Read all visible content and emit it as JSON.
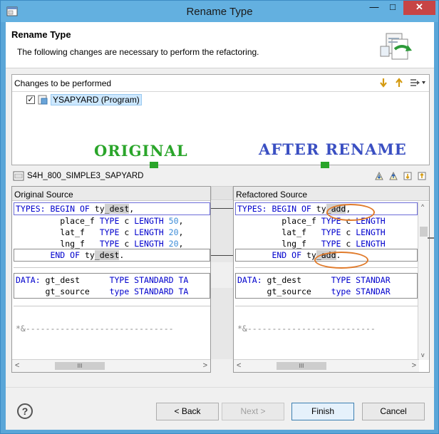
{
  "window": {
    "title": "Rename Type",
    "min_glyph": "—",
    "max_glyph": "□",
    "close_glyph": "✕"
  },
  "header": {
    "title": "Rename Type",
    "description": "The following changes are necessary to perform the refactoring."
  },
  "changes": {
    "title": "Changes to be performed",
    "item": {
      "label": "YSAPYARD (Program)",
      "checked": true
    }
  },
  "annotations": {
    "original": "ORIGINAL",
    "after": "AFTER RENAME"
  },
  "preview": {
    "file": "S4H_800_SIMPLE3_SAPYARD",
    "left_title": "Original Source",
    "right_title": "Refactored Source",
    "left_lines": {
      "l1a": "TYPES: BEGIN OF ",
      "l1b": "ty",
      "l1c": "_dest",
      "l1d": ",",
      "l2a": "         place_f ",
      "l2b": "TYPE",
      "l2c": " c ",
      "l2d": "LENGTH",
      "l2e": " 50",
      "l2f": ",",
      "l3a": "         lat_f   ",
      "l3b": "TYPE",
      "l3c": " c ",
      "l3d": "LENGTH",
      "l3e": " 20",
      "l3f": ",",
      "l4a": "         lng_f   ",
      "l4b": "TYPE",
      "l4c": " c ",
      "l4d": "LENGTH",
      "l4e": " 20",
      "l4f": ",",
      "l5a": "       END OF ",
      "l5b": "ty",
      "l5c": "_dest",
      "l5d": ".",
      "l6a": "DATA: ",
      "l6b": "gt_dest      ",
      "l6c": "TYPE STANDARD TA",
      "l7a": "      gt_source    ",
      "l7b": "type STANDARD TA",
      "l8": "*&------------------------------"
    },
    "right_lines": {
      "r1a": "TYPES: BEGIN OF ",
      "r1b": "ty",
      "r1c": "_add",
      "r1d": ",",
      "r2a": "         place_f ",
      "r2b": "TYPE",
      "r2c": " c ",
      "r2d": "LENGTH",
      "r3a": "         lat_f   ",
      "r3b": "TYPE",
      "r3c": " c ",
      "r3d": "LENGTH",
      "r4a": "         lng_f   ",
      "r4b": "TYPE",
      "r4c": " c ",
      "r4d": "LENGTH",
      "r5a": "       END OF ",
      "r5b": "ty",
      "r5c": "_add",
      "r5d": ".",
      "r6a": "DATA: ",
      "r6b": "gt_dest      ",
      "r6c": "TYPE STANDAR",
      "r7a": "      gt_source    ",
      "r7b": "type STANDAR",
      "r8": "*&--------------------------"
    },
    "scroll_left": "<",
    "scroll_right": ">",
    "scroll_up": "^",
    "scroll_down": "v",
    "scroll_grip": "III"
  },
  "footer": {
    "help": "?",
    "back": "< Back",
    "next": "Next >",
    "finish": "Finish",
    "cancel": "Cancel"
  },
  "colors": {
    "annotation_original": "#2aa52a",
    "annotation_after": "#3a4fc2",
    "ellipse": "#e07a2a",
    "arrow": "#2aa52a"
  }
}
